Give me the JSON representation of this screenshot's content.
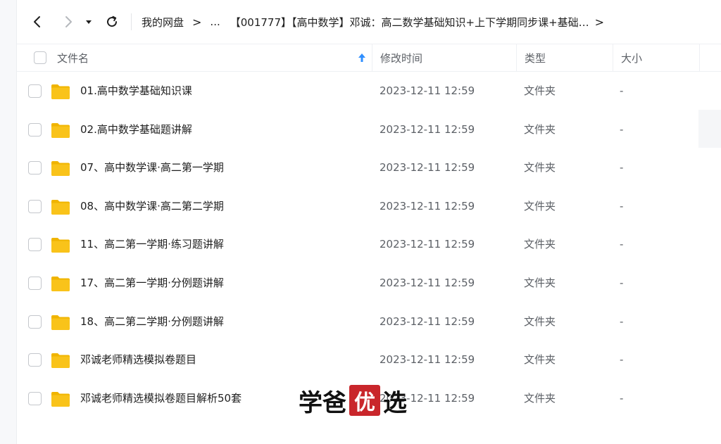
{
  "toolbar": {
    "back_icon": "chevron-left-icon",
    "forward_icon": "chevron-right-icon",
    "history_icon": "caret-down-icon",
    "refresh_icon": "refresh-icon",
    "breadcrumb": {
      "root": "我的网盘",
      "ellipsis": "...",
      "current": "【001777】【高中数学】邓诚：高二数学基础知识+上下学期同步课+基础…",
      "separator": ">",
      "more": ">"
    }
  },
  "columns": {
    "name": "文件名",
    "modified": "修改时间",
    "type": "类型",
    "size": "大小",
    "sort_icon": "sort-arrow-up-icon"
  },
  "rows": [
    {
      "name": "01.高中数学基础知识课",
      "modified": "2023-12-11 12:59",
      "type": "文件夹",
      "size": "-"
    },
    {
      "name": "02.高中数学基础题讲解",
      "modified": "2023-12-11 12:59",
      "type": "文件夹",
      "size": "-"
    },
    {
      "name": "07、高中数学课·高二第一学期",
      "modified": "2023-12-11 12:59",
      "type": "文件夹",
      "size": "-"
    },
    {
      "name": "08、高中数学课·高二第二学期",
      "modified": "2023-12-11 12:59",
      "type": "文件夹",
      "size": "-"
    },
    {
      "name": "11、高二第一学期·练习题讲解",
      "modified": "2023-12-11 12:59",
      "type": "文件夹",
      "size": "-"
    },
    {
      "name": "17、高二第一学期·分例题讲解",
      "modified": "2023-12-11 12:59",
      "type": "文件夹",
      "size": "-"
    },
    {
      "name": "18、高二第二学期·分例题讲解",
      "modified": "2023-12-11 12:59",
      "type": "文件夹",
      "size": "-"
    },
    {
      "name": "邓诚老师精选模拟卷题目",
      "modified": "2023-12-11 12:59",
      "type": "文件夹",
      "size": "-"
    },
    {
      "name": "邓诚老师精选模拟卷题目解析50套",
      "modified": "2023-12-11 12:59",
      "type": "文件夹",
      "size": "-"
    }
  ],
  "row_icon": "folder-icon",
  "watermark": {
    "part1": "学爸",
    "seal": "优",
    "part2": "选"
  },
  "colors": {
    "folder": "#f9c31a",
    "folder_tab": "#f0b400",
    "accent": "#2f8fff",
    "seal": "#c9262b"
  }
}
